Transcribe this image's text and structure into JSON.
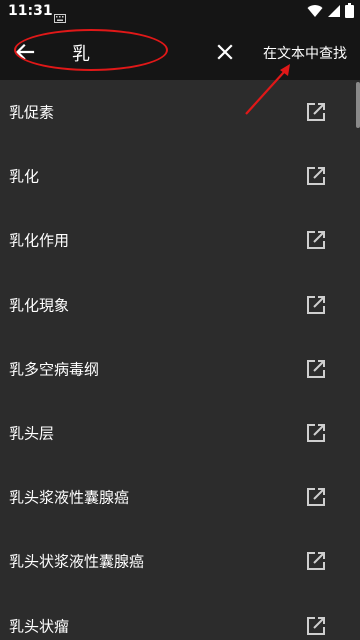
{
  "status_bar": {
    "time": "11:31"
  },
  "search": {
    "query": "乳",
    "find_in_text_label": "在文本中查找"
  },
  "results": [
    "乳促素",
    "乳化",
    "乳化作用",
    "乳化現象",
    "乳多空病毒纲",
    "乳头层",
    "乳头浆液性囊腺癌",
    "乳头状浆液性囊腺癌",
    "乳头状瘤"
  ],
  "icons": {
    "back": "arrow-left-icon",
    "clear": "close-icon",
    "open": "open-in-new-icon",
    "signal": "wifi-icon",
    "cell": "cell-signal-icon",
    "battery": "battery-icon"
  },
  "colors": {
    "annotation": "#e01818",
    "toolbar": "#151515",
    "background": "#2c2c2c"
  }
}
